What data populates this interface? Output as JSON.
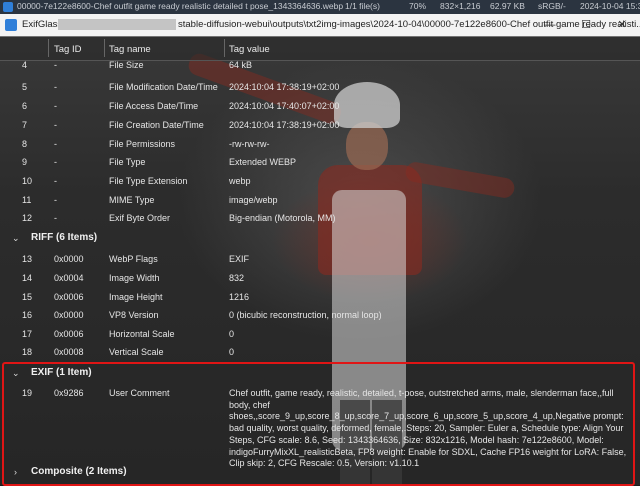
{
  "status_bar": {
    "file_name": "00000-7e122e8600-Chef outfit game ready realistic detailed t pose_1343364636.webp",
    "file_count": "1/1 file(s)",
    "zoom": "70%",
    "dimensions": "832×1,216",
    "file_size": "62.97 KB",
    "color_space": "sRGB/-",
    "date": "2024-10-04 15:38:1..."
  },
  "window": {
    "app_name": "ExifGlass v1.3 -",
    "path": "stable-diffusion-webui\\outputs\\txt2img-images\\2024-10-04\\00000-7e122e8600-Chef outfit game ready realisti...",
    "minimize": "—",
    "maximize": "☐",
    "close": "✕"
  },
  "columns": {
    "index": "",
    "tag_id": "Tag ID",
    "tag_name": "Tag name",
    "tag_value": "Tag value"
  },
  "file_rows": [
    {
      "index": "4",
      "id": "-",
      "name": "File Size",
      "value": "64 kB"
    },
    {
      "index": "5",
      "id": "-",
      "name": "File Modification Date/Time",
      "value": "2024:10:04 17:38:19+02:00"
    },
    {
      "index": "6",
      "id": "-",
      "name": "File Access Date/Time",
      "value": "2024:10:04 17:40:07+02:00"
    },
    {
      "index": "7",
      "id": "-",
      "name": "File Creation Date/Time",
      "value": "2024:10:04 17:38:19+02:00"
    },
    {
      "index": "8",
      "id": "-",
      "name": "File Permissions",
      "value": "-rw-rw-rw-"
    },
    {
      "index": "9",
      "id": "-",
      "name": "File Type",
      "value": "Extended WEBP"
    },
    {
      "index": "10",
      "id": "-",
      "name": "File Type Extension",
      "value": "webp"
    },
    {
      "index": "11",
      "id": "-",
      "name": "MIME Type",
      "value": "image/webp"
    },
    {
      "index": "12",
      "id": "-",
      "name": "Exif Byte Order",
      "value": "Big-endian (Motorola, MM)"
    }
  ],
  "riff_group": {
    "label": "RIFF (6 Items)",
    "chevron": "⌄"
  },
  "riff_rows": [
    {
      "index": "13",
      "id": "0x0000",
      "name": "WebP Flags",
      "value": "EXIF"
    },
    {
      "index": "14",
      "id": "0x0004",
      "name": "Image Width",
      "value": "832"
    },
    {
      "index": "15",
      "id": "0x0006",
      "name": "Image Height",
      "value": "1216"
    },
    {
      "index": "16",
      "id": "0x0000",
      "name": "VP8 Version",
      "value": "0 (bicubic reconstruction, normal loop)"
    },
    {
      "index": "17",
      "id": "0x0006",
      "name": "Horizontal Scale",
      "value": "0"
    },
    {
      "index": "18",
      "id": "0x0008",
      "name": "Vertical Scale",
      "value": "0"
    }
  ],
  "exif_group": {
    "label": "EXIF (1 Item)",
    "chevron": "⌄"
  },
  "exif_row": {
    "index": "19",
    "id": "0x9286",
    "name": "User Comment",
    "value": "Chef outfit, game ready, realistic, detailed, t-pose, outstretched arms, male,  slenderman face,,full body, chef shoes,,score_9_up,score_8_up,score_7_up,score_6_up,score_5_up,score_4_up,Negative prompt: bad quality, worst quality, deformed, female,.Steps: 20, Sampler: Euler a, Schedule type: Align Your Steps, CFG scale: 8.6, Seed: 1343364636, Size: 832x1216, Model hash: 7e122e8600, Model: indigoFurryMixXL_realisticBeta, FP8 weight: Enable for SDXL, Cache FP16 weight for LoRA: False, Clip skip: 2, CFG Rescale: 0.5, Version: v1.10.1"
  },
  "composite_group": {
    "label": "Composite (2 Items)",
    "chevron": "›"
  },
  "colors": {
    "highlight": "#e01515",
    "accent": "#2f7fd9"
  }
}
